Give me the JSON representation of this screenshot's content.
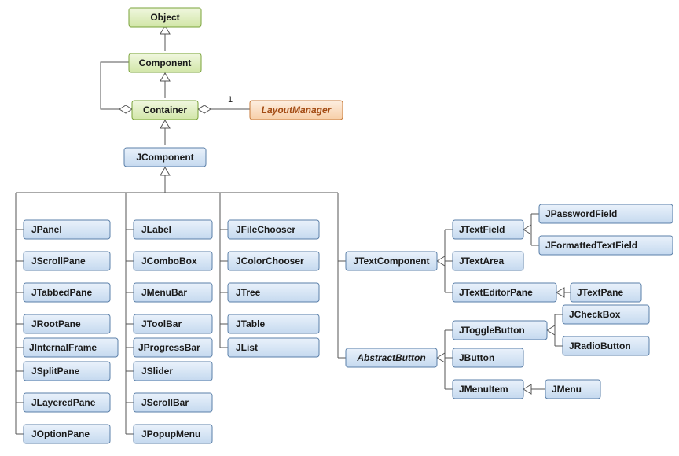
{
  "chart_data": {
    "type": "table",
    "title": "Swing / AWT class hierarchy (UML)",
    "nodes": [
      {
        "id": "Object",
        "label": "Object",
        "style": "green",
        "abstract": false
      },
      {
        "id": "Component",
        "label": "Component",
        "style": "green",
        "abstract": false
      },
      {
        "id": "Container",
        "label": "Container",
        "style": "green",
        "abstract": false
      },
      {
        "id": "LayoutManager",
        "label": "LayoutManager",
        "style": "orange",
        "abstract": true
      },
      {
        "id": "JComponent",
        "label": "JComponent",
        "style": "blue",
        "abstract": false
      },
      {
        "id": "JPanel",
        "label": "JPanel",
        "style": "blue",
        "abstract": false
      },
      {
        "id": "JScrollPane",
        "label": "JScrollPane",
        "style": "blue",
        "abstract": false
      },
      {
        "id": "JTabbedPane",
        "label": "JTabbedPane",
        "style": "blue",
        "abstract": false
      },
      {
        "id": "JRootPane",
        "label": "JRootPane",
        "style": "blue",
        "abstract": false
      },
      {
        "id": "JInternalFrame",
        "label": "JInternalFrame",
        "style": "blue",
        "abstract": false
      },
      {
        "id": "JSplitPane",
        "label": "JSplitPane",
        "style": "blue",
        "abstract": false
      },
      {
        "id": "JLayeredPane",
        "label": "JLayeredPane",
        "style": "blue",
        "abstract": false
      },
      {
        "id": "JOptionPane",
        "label": "JOptionPane",
        "style": "blue",
        "abstract": false
      },
      {
        "id": "JLabel",
        "label": "JLabel",
        "style": "blue",
        "abstract": false
      },
      {
        "id": "JComboBox",
        "label": "JComboBox",
        "style": "blue",
        "abstract": false
      },
      {
        "id": "JMenuBar",
        "label": "JMenuBar",
        "style": "blue",
        "abstract": false
      },
      {
        "id": "JToolBar",
        "label": "JToolBar",
        "style": "blue",
        "abstract": false
      },
      {
        "id": "JProgressBar",
        "label": "JProgressBar",
        "style": "blue",
        "abstract": false
      },
      {
        "id": "JSlider",
        "label": "JSlider",
        "style": "blue",
        "abstract": false
      },
      {
        "id": "JScrollBar",
        "label": "JScrollBar",
        "style": "blue",
        "abstract": false
      },
      {
        "id": "JPopupMenu",
        "label": "JPopupMenu",
        "style": "blue",
        "abstract": false
      },
      {
        "id": "JFileChooser",
        "label": "JFileChooser",
        "style": "blue",
        "abstract": false
      },
      {
        "id": "JColorChooser",
        "label": "JColorChooser",
        "style": "blue",
        "abstract": false
      },
      {
        "id": "JTree",
        "label": "JTree",
        "style": "blue",
        "abstract": false
      },
      {
        "id": "JTable",
        "label": "JTable",
        "style": "blue",
        "abstract": false
      },
      {
        "id": "JList",
        "label": "JList",
        "style": "blue",
        "abstract": false
      },
      {
        "id": "JTextComponent",
        "label": "JTextComponent",
        "style": "blue",
        "abstract": false
      },
      {
        "id": "AbstractButton",
        "label": "AbstractButton",
        "style": "blue",
        "abstract": true
      },
      {
        "id": "JTextField",
        "label": "JTextField",
        "style": "blue",
        "abstract": false
      },
      {
        "id": "JTextArea",
        "label": "JTextArea",
        "style": "blue",
        "abstract": false
      },
      {
        "id": "JTextEditorPane",
        "label": "JTextEditorPane",
        "style": "blue",
        "abstract": false
      },
      {
        "id": "JPasswordField",
        "label": "JPasswordField",
        "style": "blue",
        "abstract": false
      },
      {
        "id": "JFormattedTextField",
        "label": "JFormattedTextField",
        "style": "blue",
        "abstract": false
      },
      {
        "id": "JTextPane",
        "label": "JTextPane",
        "style": "blue",
        "abstract": false
      },
      {
        "id": "JToggleButton",
        "label": "JToggleButton",
        "style": "blue",
        "abstract": false
      },
      {
        "id": "JButton",
        "label": "JButton",
        "style": "blue",
        "abstract": false
      },
      {
        "id": "JMenuItem",
        "label": "JMenuItem",
        "style": "blue",
        "abstract": false
      },
      {
        "id": "JCheckBox",
        "label": "JCheckBox",
        "style": "blue",
        "abstract": false
      },
      {
        "id": "JRadioButton",
        "label": "JRadioButton",
        "style": "blue",
        "abstract": false
      },
      {
        "id": "JMenu",
        "label": "JMenu",
        "style": "blue",
        "abstract": false
      }
    ],
    "edges": [
      {
        "from": "Component",
        "to": "Object",
        "type": "generalization"
      },
      {
        "from": "Container",
        "to": "Component",
        "type": "generalization"
      },
      {
        "from": "JComponent",
        "to": "Container",
        "type": "generalization"
      },
      {
        "from": "Container",
        "to": "Component",
        "type": "aggregation"
      },
      {
        "from": "Container",
        "to": "LayoutManager",
        "type": "aggregation",
        "cardinality_to": "1"
      },
      {
        "from": "JPanel",
        "to": "JComponent",
        "type": "generalization"
      },
      {
        "from": "JScrollPane",
        "to": "JComponent",
        "type": "generalization"
      },
      {
        "from": "JTabbedPane",
        "to": "JComponent",
        "type": "generalization"
      },
      {
        "from": "JRootPane",
        "to": "JComponent",
        "type": "generalization"
      },
      {
        "from": "JInternalFrame",
        "to": "JComponent",
        "type": "generalization"
      },
      {
        "from": "JSplitPane",
        "to": "JComponent",
        "type": "generalization"
      },
      {
        "from": "JLayeredPane",
        "to": "JComponent",
        "type": "generalization"
      },
      {
        "from": "JOptionPane",
        "to": "JComponent",
        "type": "generalization"
      },
      {
        "from": "JLabel",
        "to": "JComponent",
        "type": "generalization"
      },
      {
        "from": "JComboBox",
        "to": "JComponent",
        "type": "generalization"
      },
      {
        "from": "JMenuBar",
        "to": "JComponent",
        "type": "generalization"
      },
      {
        "from": "JToolBar",
        "to": "JComponent",
        "type": "generalization"
      },
      {
        "from": "JProgressBar",
        "to": "JComponent",
        "type": "generalization"
      },
      {
        "from": "JSlider",
        "to": "JComponent",
        "type": "generalization"
      },
      {
        "from": "JScrollBar",
        "to": "JComponent",
        "type": "generalization"
      },
      {
        "from": "JPopupMenu",
        "to": "JComponent",
        "type": "generalization"
      },
      {
        "from": "JFileChooser",
        "to": "JComponent",
        "type": "generalization"
      },
      {
        "from": "JColorChooser",
        "to": "JComponent",
        "type": "generalization"
      },
      {
        "from": "JTree",
        "to": "JComponent",
        "type": "generalization"
      },
      {
        "from": "JTable",
        "to": "JComponent",
        "type": "generalization"
      },
      {
        "from": "JList",
        "to": "JComponent",
        "type": "generalization"
      },
      {
        "from": "JTextComponent",
        "to": "JComponent",
        "type": "generalization"
      },
      {
        "from": "AbstractButton",
        "to": "JComponent",
        "type": "generalization"
      },
      {
        "from": "JTextField",
        "to": "JTextComponent",
        "type": "generalization"
      },
      {
        "from": "JTextArea",
        "to": "JTextComponent",
        "type": "generalization"
      },
      {
        "from": "JTextEditorPane",
        "to": "JTextComponent",
        "type": "generalization"
      },
      {
        "from": "JPasswordField",
        "to": "JTextField",
        "type": "generalization"
      },
      {
        "from": "JFormattedTextField",
        "to": "JTextField",
        "type": "generalization"
      },
      {
        "from": "JTextPane",
        "to": "JTextEditorPane",
        "type": "generalization"
      },
      {
        "from": "JToggleButton",
        "to": "AbstractButton",
        "type": "generalization"
      },
      {
        "from": "JButton",
        "to": "AbstractButton",
        "type": "generalization"
      },
      {
        "from": "JMenuItem",
        "to": "AbstractButton",
        "type": "generalization"
      },
      {
        "from": "JCheckBox",
        "to": "JToggleButton",
        "type": "generalization"
      },
      {
        "from": "JRadioButton",
        "to": "JToggleButton",
        "type": "generalization"
      },
      {
        "from": "JMenu",
        "to": "JMenuItem",
        "type": "generalization"
      }
    ]
  },
  "cardinality_label": "1"
}
